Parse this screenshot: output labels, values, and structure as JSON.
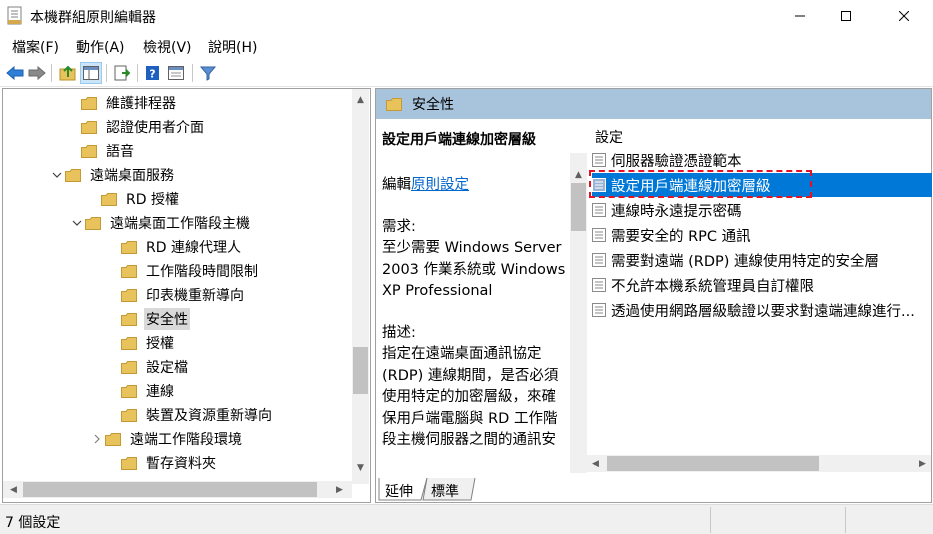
{
  "window": {
    "title": "本機群組原則編輯器",
    "controls": [
      "minimize",
      "maximize",
      "close"
    ]
  },
  "menu": [
    "檔案(F)",
    "動作(A)",
    "檢視(V)",
    "說明(H)"
  ],
  "toolbar": {
    "buttons": [
      "back-icon",
      "forward-icon",
      "up-folder-icon",
      "show-hide-tree-icon",
      "export-list-icon",
      "help-icon",
      "properties-icon",
      "filter-icon"
    ]
  },
  "tree": {
    "nodes": [
      {
        "label": "維護排程器"
      },
      {
        "label": "認證使用者介面"
      },
      {
        "label": "語音"
      },
      {
        "label": "遠端桌面服務",
        "expanded": true
      },
      {
        "label": "RD 授權"
      },
      {
        "label": "遠端桌面工作階段主機",
        "expanded": true
      },
      {
        "label": "RD 連線代理人"
      },
      {
        "label": "工作階段時間限制"
      },
      {
        "label": "印表機重新導向"
      },
      {
        "label": "安全性",
        "selected": true
      },
      {
        "label": "授權"
      },
      {
        "label": "設定檔"
      },
      {
        "label": "連線"
      },
      {
        "label": "裝置及資源重新導向"
      },
      {
        "label": "遠端工作階段環境",
        "collapsed": true
      },
      {
        "label": "暫存資料夾"
      }
    ]
  },
  "details": {
    "header": "安全性",
    "policy_title": "設定用戶端連線加密層級",
    "edit_prefix": "編輯",
    "edit_link": "原則設定",
    "requirements_label": "需求:",
    "requirements_text": "至少需要 Windows Server 2003 作業系統或 Windows XP Professional",
    "description_label": "描述:",
    "description_text": "指定在遠端桌面通訊協定 (RDP) 連線期間，是否必須使用特定的加密層級，來確保用戶端電腦與 RD 工作階段主機伺服器之間的通訊安全。當您使用原生 RDP 加密時才適用這個原則。不",
    "list_header": "設定",
    "settings": [
      {
        "label": "伺服器驗證憑證範本"
      },
      {
        "label": "設定用戶端連線加密層級",
        "selected": true
      },
      {
        "label": "連線時永遠提示密碼"
      },
      {
        "label": "需要安全的 RPC 通訊"
      },
      {
        "label": "需要對遠端 (RDP) 連線使用特定的安全層"
      },
      {
        "label": "不允許本機系統管理員自訂權限"
      },
      {
        "label": "透過使用網路層級驗證以要求對遠端連線進行..."
      }
    ]
  },
  "tabs": [
    "延伸",
    "標準"
  ],
  "status": {
    "text": "7 個設定"
  },
  "colors": {
    "header_bg": "#a8c4dd",
    "selection": "#0078d7",
    "highlight_box": "#e81123",
    "folder": "#e8c25a"
  }
}
